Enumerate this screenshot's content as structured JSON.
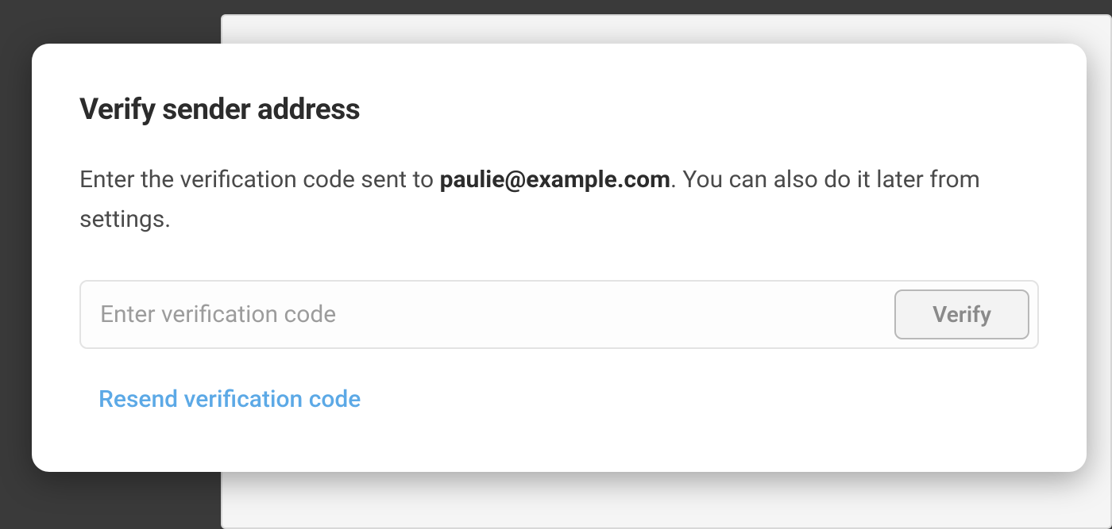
{
  "modal": {
    "title": "Verify sender address",
    "description_prefix": "Enter the verification code sent to ",
    "description_email": "paulie@example.com",
    "description_suffix": ". You can also do it later from settings.",
    "input_placeholder": "Enter verification code",
    "input_value": "",
    "verify_button_label": "Verify",
    "resend_link_label": "Resend verification code"
  }
}
